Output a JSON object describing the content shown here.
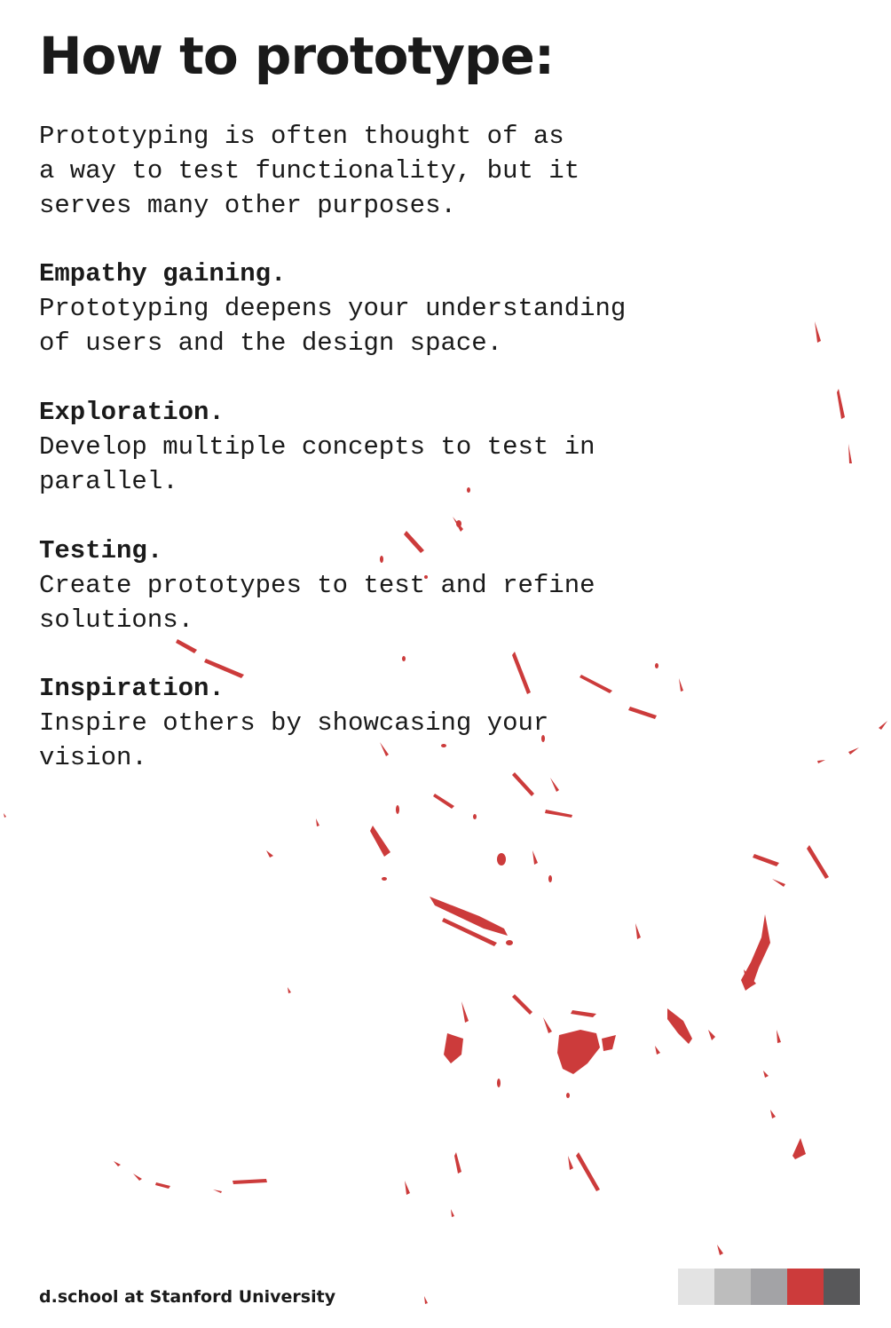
{
  "title": "How to prototype:",
  "intro": {
    "lines": [
      "Prototyping is often thought of as",
      "a way to test functionality, but it",
      "serves many other purposes."
    ]
  },
  "sections": [
    {
      "heading": "Empathy gaining.",
      "lines": [
        "Prototyping deepens your understanding",
        "of users and the design space."
      ]
    },
    {
      "heading": "Exploration.",
      "lines": [
        "Develop multiple concepts to test in",
        "parallel."
      ]
    },
    {
      "heading": "Testing.",
      "lines": [
        "Create prototypes to test and refine",
        "solutions."
      ]
    },
    {
      "heading": "Inspiration.",
      "lines": [
        "Inspire others by showcasing your",
        "vision."
      ]
    }
  ],
  "footer": {
    "label": "d.school at Stanford University"
  },
  "palette": [
    "#e3e3e3",
    "#bdbdbd",
    "#a3a3a6",
    "#cc3b3b",
    "#58585a"
  ],
  "colors": {
    "splatter": "#cc3b3b",
    "text": "#1a1a1a",
    "background": "#ffffff"
  }
}
